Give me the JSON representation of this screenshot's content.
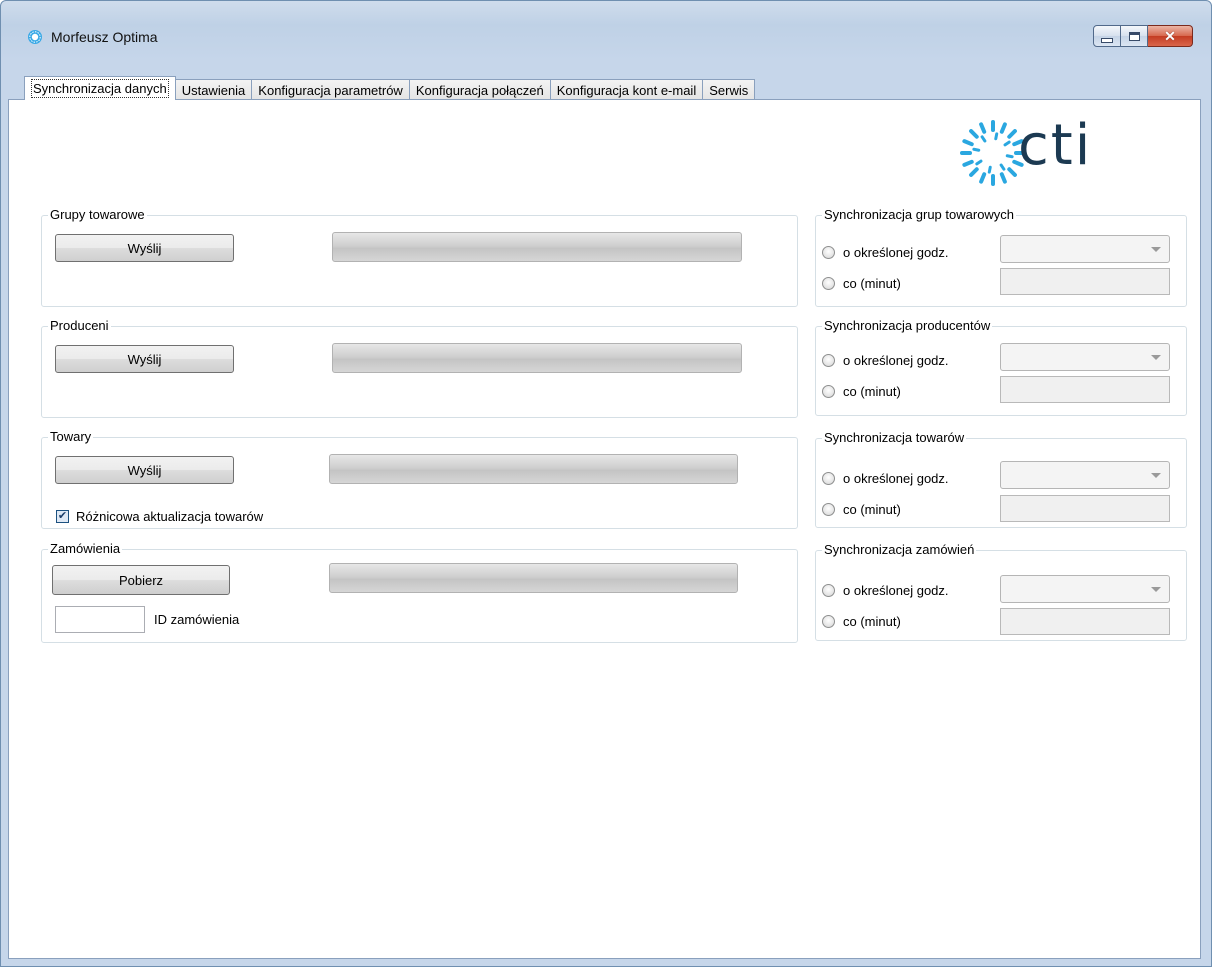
{
  "window": {
    "title": "Morfeusz Optima"
  },
  "icons": {
    "app": "app-logo-icon",
    "minimize": "minimize-icon",
    "maximize": "maximize-icon",
    "close": "close-icon",
    "combo": "chevron-down-icon",
    "check": "check-icon"
  },
  "tabs": [
    {
      "label": "Synchronizacja danych",
      "active": true
    },
    {
      "label": "Ustawienia"
    },
    {
      "label": "Konfiguracja parametrów"
    },
    {
      "label": "Konfiguracja połączeń"
    },
    {
      "label": "Konfiguracja kont e-mail"
    },
    {
      "label": "Serwis"
    }
  ],
  "logo": {
    "text": "cti",
    "color": "#1c3a52",
    "accent": "#2aa7e0"
  },
  "groups": {
    "grupy": {
      "legend": "Grupy towarowe",
      "button": "Wyślij",
      "progress": 0
    },
    "producenci": {
      "legend": "Produceni",
      "button": "Wyślij",
      "progress": 0
    },
    "towary": {
      "legend": "Towary",
      "button": "Wyślij",
      "progress": 0,
      "checkbox_label": "Różnicowa aktualizacja towarów",
      "checkbox_checked": true
    },
    "zamowienia": {
      "legend": "Zamówienia",
      "button": "Pobierz",
      "progress": 0,
      "id_label": "ID zamówienia",
      "id_value": ""
    }
  },
  "sync": {
    "grupy": {
      "legend": "Synchronizacja grup towarowych",
      "opt1": "o określonej godz.",
      "opt2": "co (minut)",
      "combo_value": "",
      "minutes_value": ""
    },
    "producenci": {
      "legend": "Synchronizacja producentów",
      "opt1": "o określonej godz.",
      "opt2": "co (minut)",
      "combo_value": "",
      "minutes_value": ""
    },
    "towary": {
      "legend": "Synchronizacja towarów",
      "opt1": "o określonej godz.",
      "opt2": "co (minut)",
      "combo_value": "",
      "minutes_value": ""
    },
    "zamowienia": {
      "legend": "Synchronizacja zamówień",
      "opt1": "o określonej godz.",
      "opt2": "co (minut)",
      "combo_value": "",
      "minutes_value": ""
    }
  }
}
